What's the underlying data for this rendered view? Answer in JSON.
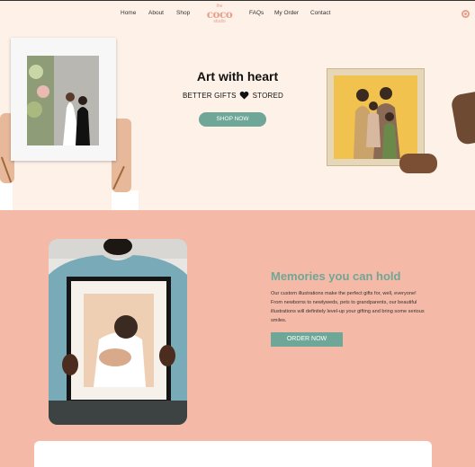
{
  "nav": {
    "items": [
      "Home",
      "About",
      "Shop",
      "FAQs",
      "My Order",
      "Contact"
    ],
    "logo": {
      "line1": "the",
      "line2": "coco",
      "line3": "studio"
    },
    "search_icon": "search-icon"
  },
  "hero": {
    "title": "Art with heart",
    "subtitle_left": "BETTER GIFTS",
    "subtitle_icon": "heart-icon",
    "subtitle_right": "STORED",
    "button": "SHOP NOW"
  },
  "memories": {
    "title": "Memories you can hold",
    "text": "Our custom illustrations make the perfect gifts for, well, everyone! From newborns to newlyweds, pets to grandparents, our beautiful illustrations will definitely level-up your gifting and bring some serious smiles.",
    "button": "ORDER NOW"
  },
  "colors": {
    "accent": "#6ea797",
    "brand": "#e8a08c",
    "hero_bg": "#fdf1e8",
    "section_bg": "#f5b9a7"
  }
}
